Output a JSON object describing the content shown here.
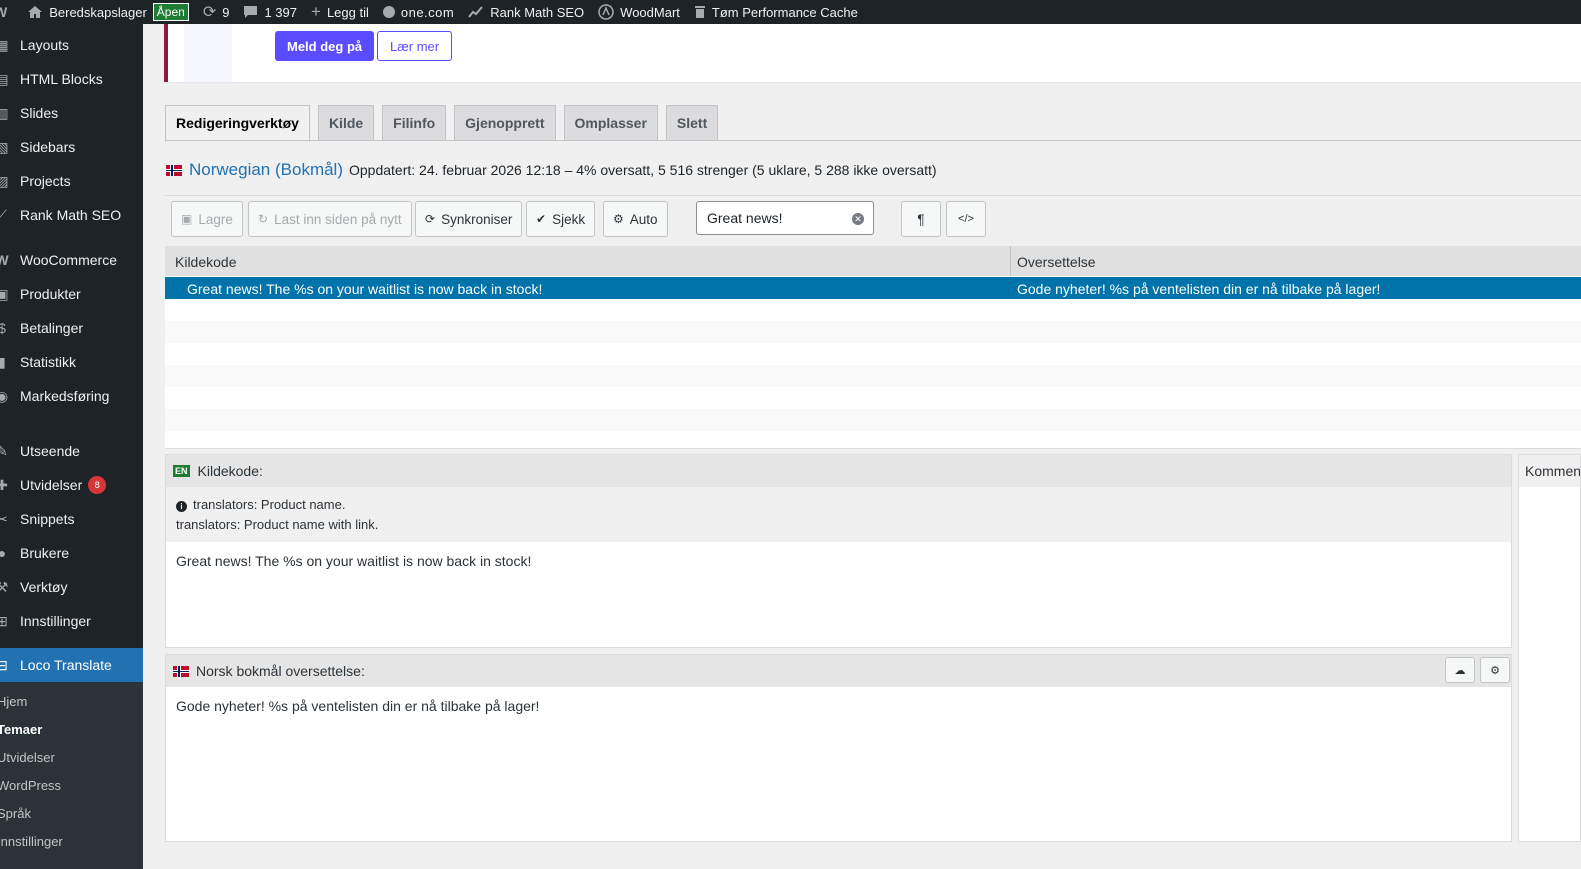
{
  "adminbar": {
    "site_name": "Beredskapslager",
    "status": "Åpen",
    "updates": "9",
    "comments": "1 397",
    "new": "Legg til",
    "host": "one.com",
    "seo": "Rank Math SEO",
    "theme": "WoodMart",
    "cache": "Tøm Performance Cache"
  },
  "sidebar": {
    "items": [
      {
        "label": "Layouts",
        "icon": "layout-icon"
      },
      {
        "label": "HTML Blocks",
        "icon": "html-icon"
      },
      {
        "label": "Slides",
        "icon": "slides-icon"
      },
      {
        "label": "Sidebars",
        "icon": "sidebar-icon"
      },
      {
        "label": "Projects",
        "icon": "portfolio-icon"
      },
      {
        "label": "Rank Math SEO",
        "icon": "rankmath-icon"
      },
      {
        "label": "WooCommerce",
        "icon": "woo-icon"
      },
      {
        "label": "Produkter",
        "icon": "archive-icon"
      },
      {
        "label": "Betalinger",
        "icon": "money-icon"
      },
      {
        "label": "Statistikk",
        "icon": "chart-icon"
      },
      {
        "label": "Markedsføring",
        "icon": "megaphone-icon"
      },
      {
        "label": "Utseende",
        "icon": "brush-icon"
      },
      {
        "label": "Utvidelser",
        "icon": "plugin-icon",
        "badge": "8"
      },
      {
        "label": "Snippets",
        "icon": "scissors-icon"
      },
      {
        "label": "Brukere",
        "icon": "users-icon"
      },
      {
        "label": "Verktøy",
        "icon": "wrench-icon"
      },
      {
        "label": "Innstillinger",
        "icon": "settings-icon"
      },
      {
        "label": "Loco Translate",
        "icon": "translate-icon"
      }
    ],
    "submenu": [
      "Hjem",
      "Temaer",
      "Utvidelser",
      "WordPress",
      "Språk",
      "Innstillinger"
    ]
  },
  "notice": {
    "primary_button": "Meld deg på",
    "secondary_button": "Lær mer"
  },
  "tabs": [
    "Redigeringverktøy",
    "Kilde",
    "Filinfo",
    "Gjenopprett",
    "Omplasser",
    "Slett"
  ],
  "language": {
    "name": "Norwegian (Bokmål)",
    "meta": "Oppdatert: 24. februar 2026 12:18 – 4% oversatt, 5 516 strenger (5 uklare, 5 288 ikke oversatt)"
  },
  "toolbar": {
    "save": "Lagre",
    "reload": "Last inn siden på nytt",
    "sync": "Synkroniser",
    "check": "Sjekk",
    "auto": "Auto",
    "search_value": "Great news!",
    "pilcrow": "¶",
    "code": "</>"
  },
  "grid": {
    "col_source": "Kildekode",
    "col_target": "Oversettelse",
    "rows": [
      {
        "source": "Great news! The %s on your waitlist is now back in stock!",
        "target": "Gode nyheter! %s på ventelisten din er nå tilbake på lager!"
      }
    ]
  },
  "source_pane": {
    "lang_badge": "EN",
    "title": "Kildekode:",
    "note1": "translators: Product name.",
    "note2": "translators: Product name with link.",
    "text": "Great news! The %s on your waitlist is now back in stock!"
  },
  "target_pane": {
    "title": "Norsk bokmål oversettelse:",
    "text": "Gode nyheter! %s på ventelisten din er nå tilbake på lager!"
  },
  "comments_pane": {
    "title": "Kommentarer"
  },
  "colors": {
    "admin_bg": "#1d2327",
    "accent": "#2271b1",
    "selected_row": "#0073aa",
    "notice_button": "#5b4cff"
  }
}
